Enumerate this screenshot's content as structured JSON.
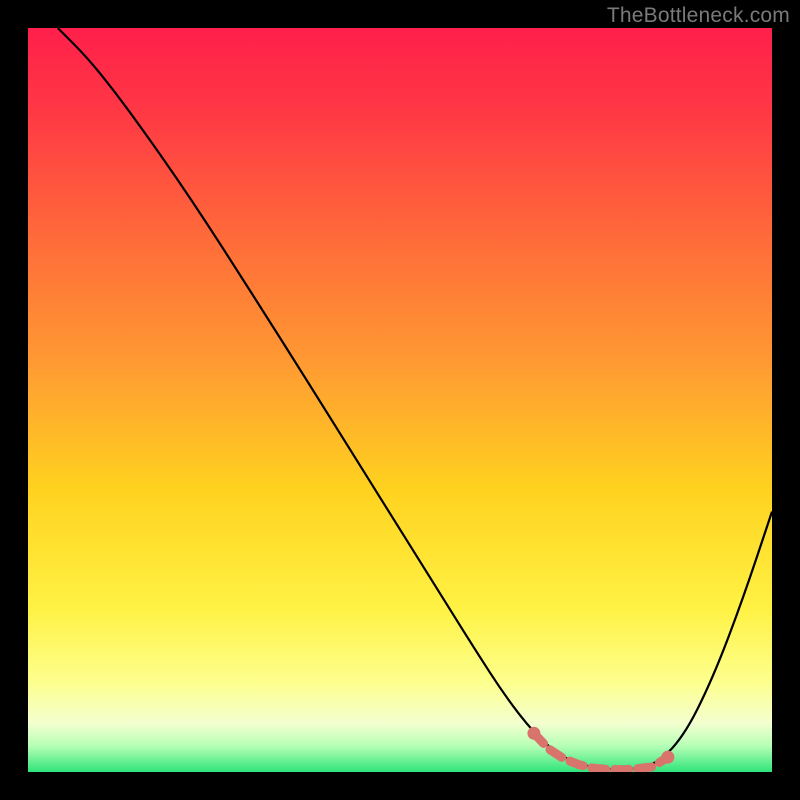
{
  "attribution": "TheBottleneck.com",
  "chart_data": {
    "type": "line",
    "title": "",
    "xlabel": "",
    "ylabel": "",
    "xlim": [
      0,
      100
    ],
    "ylim": [
      0,
      100
    ],
    "grid": false,
    "legend": false,
    "background_gradient": {
      "stops": [
        {
          "offset": 0.0,
          "color": "#ff1f4b"
        },
        {
          "offset": 0.12,
          "color": "#ff3a44"
        },
        {
          "offset": 0.28,
          "color": "#ff6a3a"
        },
        {
          "offset": 0.45,
          "color": "#ff9a32"
        },
        {
          "offset": 0.62,
          "color": "#ffd21f"
        },
        {
          "offset": 0.78,
          "color": "#fff244"
        },
        {
          "offset": 0.88,
          "color": "#fdff8e"
        },
        {
          "offset": 0.935,
          "color": "#f3ffd0"
        },
        {
          "offset": 0.965,
          "color": "#b6ffb6"
        },
        {
          "offset": 1.0,
          "color": "#2fe57a"
        }
      ]
    },
    "series": [
      {
        "name": "bottleneck-curve",
        "color": "#000000",
        "x": [
          4,
          8,
          12,
          16,
          20,
          24,
          28,
          32,
          36,
          40,
          44,
          48,
          52,
          56,
          60,
          64,
          68,
          72,
          76,
          80,
          84,
          88,
          92,
          96,
          100
        ],
        "y": [
          100,
          96,
          91,
          85.5,
          79.8,
          73.8,
          67.6,
          61.3,
          55,
          48.6,
          42.2,
          35.8,
          29.4,
          23,
          16.6,
          10.4,
          5.2,
          1.8,
          0.5,
          0.3,
          0.7,
          4.5,
          12.5,
          23,
          35
        ]
      }
    ],
    "highlight": {
      "name": "optimal-range",
      "color": "#d9746c",
      "x": [
        68,
        70,
        72,
        74,
        76,
        78,
        80,
        82,
        84,
        86
      ],
      "y": [
        5.2,
        3.1,
        1.8,
        1.0,
        0.5,
        0.35,
        0.3,
        0.45,
        0.7,
        2.0
      ]
    }
  }
}
